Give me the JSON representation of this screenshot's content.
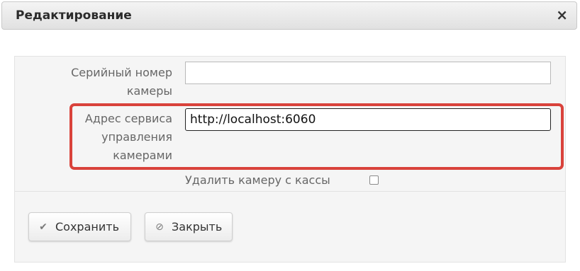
{
  "dialog": {
    "title": "Редактирование",
    "close_glyph": "×"
  },
  "form": {
    "serial_label_line1": "Серийный номер",
    "serial_label_line2": "камеры",
    "serial_value": "",
    "service_label_line1": "Адрес сервиса",
    "service_label_line2": "управления",
    "service_label_line3": "камерами",
    "service_value": "http://localhost:6060",
    "delete_label": "Удалить камеру с кассы",
    "delete_checked": false
  },
  "buttons": {
    "save_label": "Сохранить",
    "save_icon": "check-icon",
    "close_label": "Закрыть",
    "close_icon": "ban-icon"
  },
  "colors": {
    "highlight": "#d9423b"
  }
}
